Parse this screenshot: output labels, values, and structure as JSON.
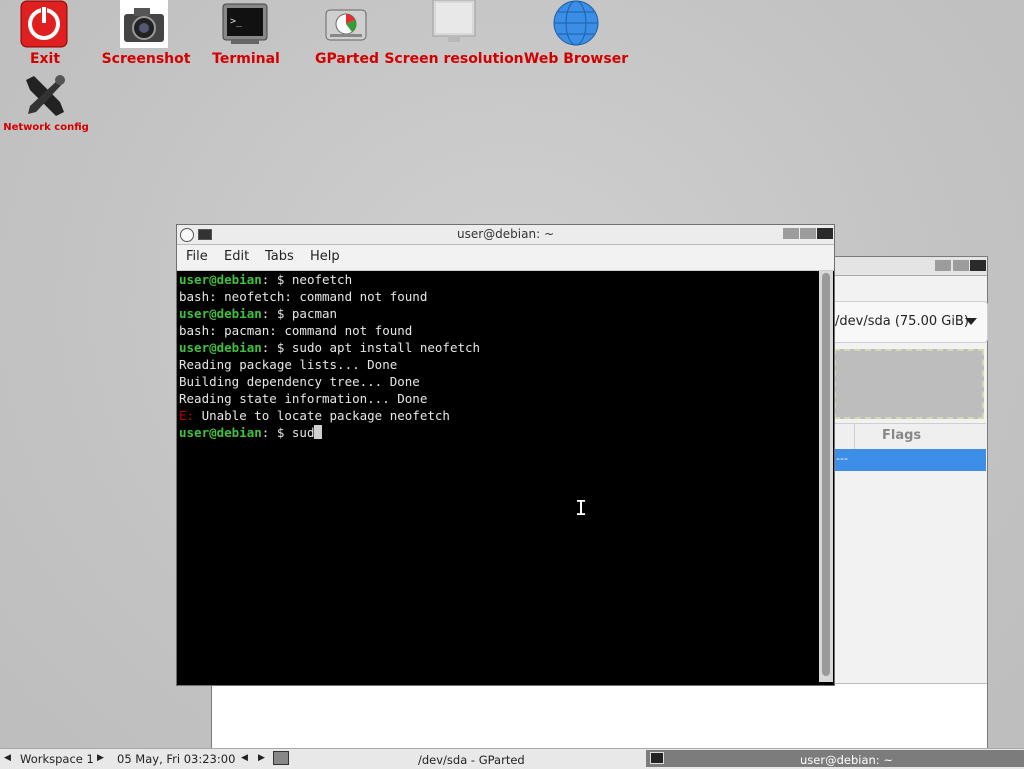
{
  "desktop": {
    "icons": [
      {
        "label": "Exit",
        "icon": "power-icon"
      },
      {
        "label": "Screenshot",
        "icon": "camera-icon"
      },
      {
        "label": "Terminal",
        "icon": "terminal-icon"
      },
      {
        "label": "GParted",
        "icon": "disk-icon"
      },
      {
        "label": "Screen resolution",
        "icon": "monitor-icon"
      },
      {
        "label": "Web Browser",
        "icon": "globe-icon"
      },
      {
        "label": "Network config",
        "icon": "tools-icon"
      }
    ],
    "label_color": "#d40000"
  },
  "gparted": {
    "device": "/dev/sda (75.00 GiB)",
    "column_flags": "Flags",
    "selected_row_text": "---"
  },
  "terminal": {
    "title": "user@debian: ~",
    "menu": [
      "File",
      "Edit",
      "Tabs",
      "Help"
    ],
    "prompt_user": "user@debian",
    "prompt_suffix": ": $ ",
    "lines": [
      {
        "type": "prompt",
        "cmd": "neofetch"
      },
      {
        "type": "out",
        "text": "bash: neofetch: command not found"
      },
      {
        "type": "prompt",
        "cmd": "pacman"
      },
      {
        "type": "out",
        "text": "bash: pacman: command not found"
      },
      {
        "type": "prompt",
        "cmd": "sudo apt install neofetch"
      },
      {
        "type": "out",
        "text": "Reading package lists... Done"
      },
      {
        "type": "out",
        "text": "Building dependency tree... Done"
      },
      {
        "type": "out",
        "text": "Reading state information... Done"
      },
      {
        "type": "err",
        "prefix": "E:",
        "text": " Unable to locate package neofetch"
      },
      {
        "type": "prompt",
        "cmd": "sud",
        "cursor": true
      }
    ],
    "prompt_color": "#41c03f",
    "error_color": "#c00000"
  },
  "taskbar": {
    "workspace": "Workspace 1",
    "clock": "05 May, Fri 03:23:00",
    "tasks": [
      "/dev/sda - GParted",
      "user@debian: ~"
    ]
  }
}
